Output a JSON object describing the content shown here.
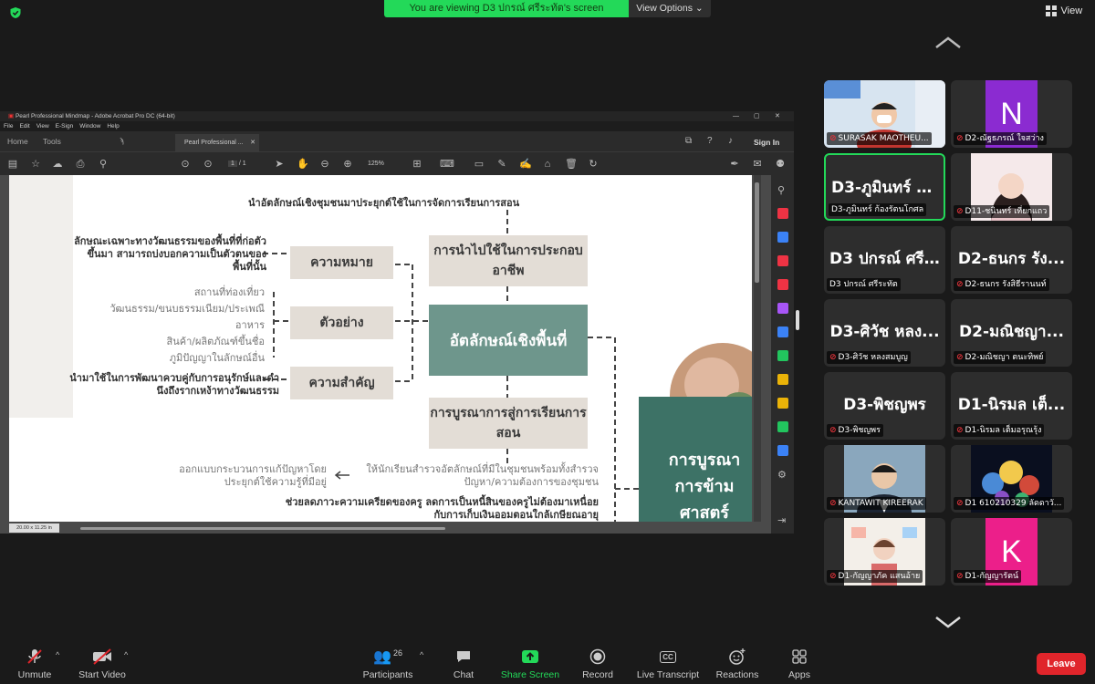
{
  "meeting": {
    "banner_text": "You are viewing D3 ปกรณ์ ศรีระทัต's screen",
    "view_options_label": "View Options",
    "view_label": "View"
  },
  "shared_window": {
    "title": "Pearl Professional Mindmap - Adobe Acrobat Pro DC (64-bit)",
    "menu": [
      "File",
      "Edit",
      "View",
      "E-Sign",
      "Window",
      "Help"
    ],
    "tabs": {
      "home": "Home",
      "tools": "Tools",
      "doc": "Pearl Professional ..."
    },
    "sign_in": "Sign In",
    "page_current": "1",
    "page_total": "/ 1",
    "zoom": "125%",
    "page_size": "20.00 x 11.25 in"
  },
  "mindmap": {
    "top_caption": "นำอัตลักษณ์เชิงชุมชนมาประยุกต์ใช้ในการจัดการเรียนการสอน",
    "center": "อัตลักษณ์เชิงพื้นที่",
    "top_box": "การนำไปใช้ในการประกอบอาชีพ",
    "bottom_box": "การบูรณาการสู่การเรียนการสอน",
    "right_box": "การบูรณาการข้ามศาสตร์",
    "meaning_box": "ความหมาย",
    "example_box": "ตัวอย่าง",
    "importance_box": "ความสำคัญ",
    "meaning_text": "ลักษณะเฉพาะทางวัฒนธรรมของพื้นที่ที่ก่อตัวขึ้นมา สามารถบ่งบอกความเป็นตัวตนของพื้นที่นั้น",
    "examples": [
      "สถานที่ท่องเที่ยว",
      "วัฒนธรรม/ขนบธรรมเนียม/ประเพณี",
      "อาหาร",
      "สินค้า/ผลิตภัณฑ์ขึ้นชื่อ",
      "ภูมิปัญญาในลักษณ์อื่น"
    ],
    "importance_text": "นำมาใช้ในการพัฒนาควบคู่กับการอนุรักษ์และดำนึงถึงรากเหง้าทางวัฒนธรรม",
    "design_text": "ออกแบบกระบวนการแก้ปัญหาโดยประยุกต์ใช้ความรู้ที่มีอยู่",
    "student_text": "ให้นักเรียนสำรวจอัตลักษณ์ที่มีในชุมชนพร้อมทั้งสำรวจปัญหา/ความต้องการของชุมชน",
    "bottom_text": "ช่วยลดภาวะความเครียดของครู ลดการเป็นหนี้สินของครูไม่ต้องมาเหนื่อยกับการเก็บเงินออมตอนใกล้เกษียณอายุ"
  },
  "participants": [
    {
      "name": "SURASAK MAOTHEU...",
      "big": "",
      "kind": "video",
      "muted": true
    },
    {
      "name": "D2-ณัฐธภรณ์ ใจสว่าง",
      "big": "N",
      "kind": "letter",
      "color": "#8b2bd1",
      "muted": true
    },
    {
      "name": "D3-ภูมินทร์ ก้องรัตนโกศล",
      "big": "D3-ภูมินทร์ ก้...",
      "kind": "text",
      "muted": false,
      "active": true
    },
    {
      "name": "D11-ชนินทร์ เที่ยกแถว",
      "big": "",
      "kind": "photo",
      "muted": true
    },
    {
      "name": "D3 ปกรณ์ ศรีระทัต",
      "big": "D3 ปกรณ์ ศรี...",
      "kind": "text",
      "muted": false
    },
    {
      "name": "D2-ธนกร รังสิธีรานนท์",
      "big": "D2-ธนกร รัง...",
      "kind": "text",
      "muted": true
    },
    {
      "name": "D3-ศิวัช หลงสมบูญ",
      "big": "D3-ศิวัช หลง...",
      "kind": "text",
      "muted": true
    },
    {
      "name": "D2-มณิชญา ตนะทิพย์",
      "big": "D2-มณิชญา...",
      "kind": "text",
      "muted": true
    },
    {
      "name": "D3-พิชญพร",
      "big": "D3-พิชญพร",
      "kind": "text",
      "muted": true
    },
    {
      "name": "D1-นิรมล เต็มอรุณรุ้ง",
      "big": "D1-นิรมล เต็...",
      "kind": "text",
      "muted": true
    },
    {
      "name": "KANTAWIT KIREERAK",
      "big": "",
      "kind": "photo2",
      "muted": true
    },
    {
      "name": "D1 610210329 ลัดดาวั...",
      "big": "",
      "kind": "photo3",
      "muted": true
    },
    {
      "name": "D1-กัญญาภัค แสนอ้าย",
      "big": "",
      "kind": "photo4",
      "muted": true
    },
    {
      "name": "D1-กัญญารัตน์",
      "big": "K",
      "kind": "letter",
      "color": "#ec1f8a",
      "muted": true
    }
  ],
  "toolbar": {
    "unmute": "Unmute",
    "start_video": "Start Video",
    "participants": "Participants",
    "participants_count": "26",
    "chat": "Chat",
    "share_screen": "Share Screen",
    "record": "Record",
    "live_transcript": "Live Transcript",
    "reactions": "Reactions",
    "apps": "Apps",
    "leave": "Leave"
  },
  "colors": {
    "share_green": "#23d959",
    "leave_red": "#e0252b",
    "mindmap_green": "#6e968c",
    "mindmap_dark": "#3d7266",
    "mindmap_beige": "#e3ddd6"
  }
}
